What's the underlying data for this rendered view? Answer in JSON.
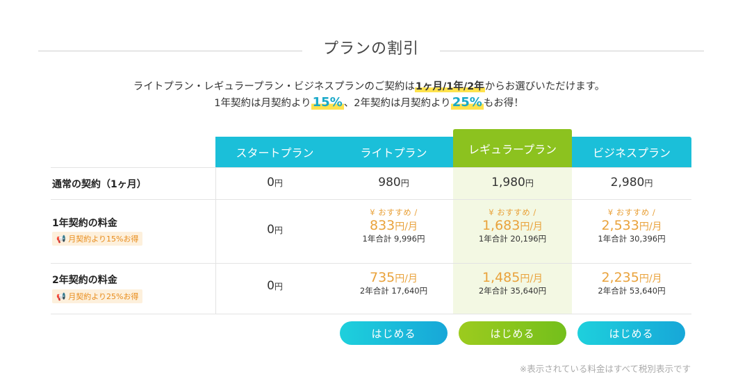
{
  "section_title": "プランの割引",
  "intro": {
    "line1_before": "ライトプラン・レギュラープラン・ビジネスプランのご契約は",
    "line1_highlight": "1ヶ月/1年/2年",
    "line1_after": "からお選びいただけます。",
    "line2_part1": "1年契約は月契約より",
    "line2_pct1": "15%",
    "line2_part2": "、2年契約は月契約より",
    "line2_pct2": "25%",
    "line2_part3": "もお得！"
  },
  "plans": [
    "スタートプラン",
    "ライトプラン",
    "レギュラープラン",
    "ビジネスプラン"
  ],
  "rows": {
    "monthly": {
      "label": "通常の契約（1ヶ月）",
      "prices": [
        "0",
        "980",
        "1,980",
        "2,980"
      ],
      "unit": "円"
    },
    "one_year": {
      "label": "1年契約の料金",
      "discount": "月契約より15%お得",
      "start_price": "0",
      "rec_label": "¥ おすすめ /",
      "prices": [
        "833",
        "1,683",
        "2,533"
      ],
      "totals": [
        "1年合計 9,996円",
        "1年合計 20,196円",
        "1年合計 30,396円"
      ]
    },
    "two_year": {
      "label": "2年契約の料金",
      "discount": "月契約より25%お得",
      "start_price": "0",
      "prices": [
        "735",
        "1,485",
        "2,235"
      ],
      "totals": [
        "2年合計 17,640円",
        "2年合計 35,640円",
        "2年合計 53,640円"
      ]
    }
  },
  "units": {
    "yen": "円",
    "per_month": "円/月"
  },
  "buttons": [
    "はじめる",
    "はじめる",
    "はじめる"
  ],
  "footnote": "※表示されている料金はすべて税別表示です",
  "colors": {
    "header_cyan": "#1bbfd9",
    "header_green": "#8cc21f",
    "price_orange": "#e9a23b",
    "highlight_yellow": "#ffe24d"
  }
}
